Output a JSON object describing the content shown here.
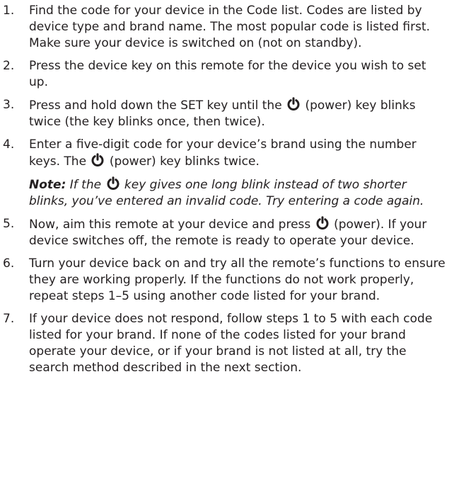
{
  "power_icon": "power-icon",
  "steps": [
    {
      "number": "1.",
      "text": "Find the code for your device in the Code list. Codes are listed by device type and brand name. The most popular code is listed first. Make sure your device is switched on (not on standby)."
    },
    {
      "number": "2.",
      "text": "Press the device key on this remote for the device you wish to set up."
    },
    {
      "number": "3.",
      "text_a": "Press and hold down the SET key until the",
      "text_b": "(power) key blinks twice (the key blinks once, then twice)."
    },
    {
      "number": "4.",
      "text_a": "Enter a five-digit code for your device’s brand using the number keys. The",
      "text_b": "(power) key blinks twice.",
      "note_label": "Note:",
      "note_a": "If the",
      "note_b": "key gives one long blink instead of two shorter blinks, you’ve entered an invalid code. Try entering a code again."
    },
    {
      "number": "5.",
      "text_a": "Now, aim this remote at your device and press",
      "text_b": "(power). If your device switches off, the remote is ready to operate your device."
    },
    {
      "number": "6.",
      "text": "Turn your device back on and try all the remote’s functions to ensure they are working properly. If the functions do not work properly, repeat steps 1–5 using another code listed for your brand."
    },
    {
      "number": "7.",
      "text": "If your device does not respond, follow steps 1 to 5 with each code listed for your brand. If none of the codes listed for your brand operate your device, or if your brand is not listed at all, try the search method described in the next section."
    }
  ]
}
